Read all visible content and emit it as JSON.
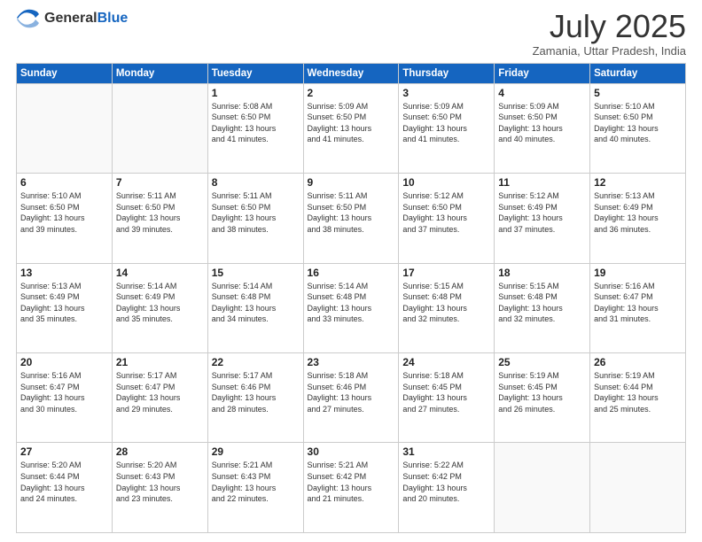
{
  "header": {
    "logo_general": "General",
    "logo_blue": "Blue",
    "title": "July 2025",
    "subtitle": "Zamania, Uttar Pradesh, India"
  },
  "days_of_week": [
    "Sunday",
    "Monday",
    "Tuesday",
    "Wednesday",
    "Thursday",
    "Friday",
    "Saturday"
  ],
  "weeks": [
    [
      {
        "day": "",
        "info": ""
      },
      {
        "day": "",
        "info": ""
      },
      {
        "day": "1",
        "sunrise": "5:08 AM",
        "sunset": "6:50 PM",
        "daylight": "13 hours and 41 minutes."
      },
      {
        "day": "2",
        "sunrise": "5:09 AM",
        "sunset": "6:50 PM",
        "daylight": "13 hours and 41 minutes."
      },
      {
        "day": "3",
        "sunrise": "5:09 AM",
        "sunset": "6:50 PM",
        "daylight": "13 hours and 41 minutes."
      },
      {
        "day": "4",
        "sunrise": "5:09 AM",
        "sunset": "6:50 PM",
        "daylight": "13 hours and 40 minutes."
      },
      {
        "day": "5",
        "sunrise": "5:10 AM",
        "sunset": "6:50 PM",
        "daylight": "13 hours and 40 minutes."
      }
    ],
    [
      {
        "day": "6",
        "sunrise": "5:10 AM",
        "sunset": "6:50 PM",
        "daylight": "13 hours and 39 minutes."
      },
      {
        "day": "7",
        "sunrise": "5:11 AM",
        "sunset": "6:50 PM",
        "daylight": "13 hours and 39 minutes."
      },
      {
        "day": "8",
        "sunrise": "5:11 AM",
        "sunset": "6:50 PM",
        "daylight": "13 hours and 38 minutes."
      },
      {
        "day": "9",
        "sunrise": "5:11 AM",
        "sunset": "6:50 PM",
        "daylight": "13 hours and 38 minutes."
      },
      {
        "day": "10",
        "sunrise": "5:12 AM",
        "sunset": "6:50 PM",
        "daylight": "13 hours and 37 minutes."
      },
      {
        "day": "11",
        "sunrise": "5:12 AM",
        "sunset": "6:49 PM",
        "daylight": "13 hours and 37 minutes."
      },
      {
        "day": "12",
        "sunrise": "5:13 AM",
        "sunset": "6:49 PM",
        "daylight": "13 hours and 36 minutes."
      }
    ],
    [
      {
        "day": "13",
        "sunrise": "5:13 AM",
        "sunset": "6:49 PM",
        "daylight": "13 hours and 35 minutes."
      },
      {
        "day": "14",
        "sunrise": "5:14 AM",
        "sunset": "6:49 PM",
        "daylight": "13 hours and 35 minutes."
      },
      {
        "day": "15",
        "sunrise": "5:14 AM",
        "sunset": "6:48 PM",
        "daylight": "13 hours and 34 minutes."
      },
      {
        "day": "16",
        "sunrise": "5:14 AM",
        "sunset": "6:48 PM",
        "daylight": "13 hours and 33 minutes."
      },
      {
        "day": "17",
        "sunrise": "5:15 AM",
        "sunset": "6:48 PM",
        "daylight": "13 hours and 32 minutes."
      },
      {
        "day": "18",
        "sunrise": "5:15 AM",
        "sunset": "6:48 PM",
        "daylight": "13 hours and 32 minutes."
      },
      {
        "day": "19",
        "sunrise": "5:16 AM",
        "sunset": "6:47 PM",
        "daylight": "13 hours and 31 minutes."
      }
    ],
    [
      {
        "day": "20",
        "sunrise": "5:16 AM",
        "sunset": "6:47 PM",
        "daylight": "13 hours and 30 minutes."
      },
      {
        "day": "21",
        "sunrise": "5:17 AM",
        "sunset": "6:47 PM",
        "daylight": "13 hours and 29 minutes."
      },
      {
        "day": "22",
        "sunrise": "5:17 AM",
        "sunset": "6:46 PM",
        "daylight": "13 hours and 28 minutes."
      },
      {
        "day": "23",
        "sunrise": "5:18 AM",
        "sunset": "6:46 PM",
        "daylight": "13 hours and 27 minutes."
      },
      {
        "day": "24",
        "sunrise": "5:18 AM",
        "sunset": "6:45 PM",
        "daylight": "13 hours and 27 minutes."
      },
      {
        "day": "25",
        "sunrise": "5:19 AM",
        "sunset": "6:45 PM",
        "daylight": "13 hours and 26 minutes."
      },
      {
        "day": "26",
        "sunrise": "5:19 AM",
        "sunset": "6:44 PM",
        "daylight": "13 hours and 25 minutes."
      }
    ],
    [
      {
        "day": "27",
        "sunrise": "5:20 AM",
        "sunset": "6:44 PM",
        "daylight": "13 hours and 24 minutes."
      },
      {
        "day": "28",
        "sunrise": "5:20 AM",
        "sunset": "6:43 PM",
        "daylight": "13 hours and 23 minutes."
      },
      {
        "day": "29",
        "sunrise": "5:21 AM",
        "sunset": "6:43 PM",
        "daylight": "13 hours and 22 minutes."
      },
      {
        "day": "30",
        "sunrise": "5:21 AM",
        "sunset": "6:42 PM",
        "daylight": "13 hours and 21 minutes."
      },
      {
        "day": "31",
        "sunrise": "5:22 AM",
        "sunset": "6:42 PM",
        "daylight": "13 hours and 20 minutes."
      },
      {
        "day": "",
        "info": ""
      },
      {
        "day": "",
        "info": ""
      }
    ]
  ]
}
